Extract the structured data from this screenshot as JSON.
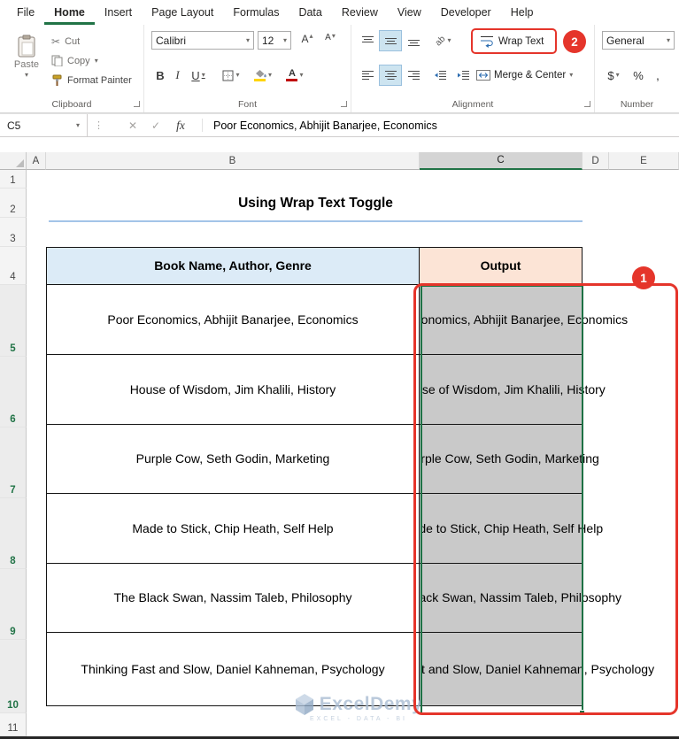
{
  "ribbon_tabs": [
    "File",
    "Home",
    "Insert",
    "Page Layout",
    "Formulas",
    "Data",
    "Review",
    "View",
    "Developer",
    "Help"
  ],
  "active_tab": "Home",
  "groups": {
    "clipboard": {
      "label": "Clipboard",
      "paste": "Paste",
      "cut": "Cut",
      "copy": "Copy",
      "format_painter": "Format Painter"
    },
    "font": {
      "label": "Font",
      "name": "Calibri",
      "size": "12",
      "bold": "B",
      "italic": "I",
      "underline": "U",
      "letter": "A"
    },
    "alignment": {
      "label": "Alignment",
      "wrap_text": "Wrap Text",
      "merge_center": "Merge & Center",
      "orientation": "ab"
    },
    "number": {
      "label": "Number",
      "format": "General",
      "currency": "$",
      "percent": "%",
      "comma": ","
    }
  },
  "formula_bar": {
    "name_box": "C5",
    "fx": "fx",
    "formula": "Poor Economics, Abhijit Banarjee, Economics"
  },
  "icons": {
    "dropdown": "▾",
    "up_arrow": "▴",
    "close": "✕",
    "check": "✓",
    "dots": "⋮",
    "scissors": "✂"
  },
  "sheet": {
    "column_headers": [
      "A",
      "B",
      "C",
      "D",
      "E"
    ],
    "row_headers": [
      "1",
      "2",
      "3",
      "4",
      "5",
      "6",
      "7",
      "8",
      "9",
      "10",
      "11"
    ],
    "title": "Using Wrap Text Toggle",
    "table": {
      "col1_header": "Book Name, Author, Genre",
      "col2_header": "Output",
      "rows": [
        {
          "text": "Poor Economics, Abhijit Banarjee, Economics"
        },
        {
          "text": "House of Wisdom, Jim Khalili, History"
        },
        {
          "text": "Purple Cow, Seth Godin, Marketing"
        },
        {
          "text": "Made to Stick, Chip Heath, Self Help"
        },
        {
          "text": "The Black Swan, Nassim Taleb, Philosophy"
        },
        {
          "text": "Thinking Fast and Slow, Daniel Kahneman, Psychology"
        }
      ]
    },
    "selection_fill": "#C9C9C9"
  },
  "watermark": {
    "brand": "ExcelDemy",
    "tagline": "EXCEL - DATA - BI"
  },
  "annotations": {
    "step_one": "1",
    "step_two": "2",
    "red": "#E5352B"
  },
  "colors": {
    "excel_green": "#217346",
    "header_blue": "#DCEBF7",
    "header_peach": "#FCE4D6",
    "title_underline": "#A3C4E8"
  }
}
